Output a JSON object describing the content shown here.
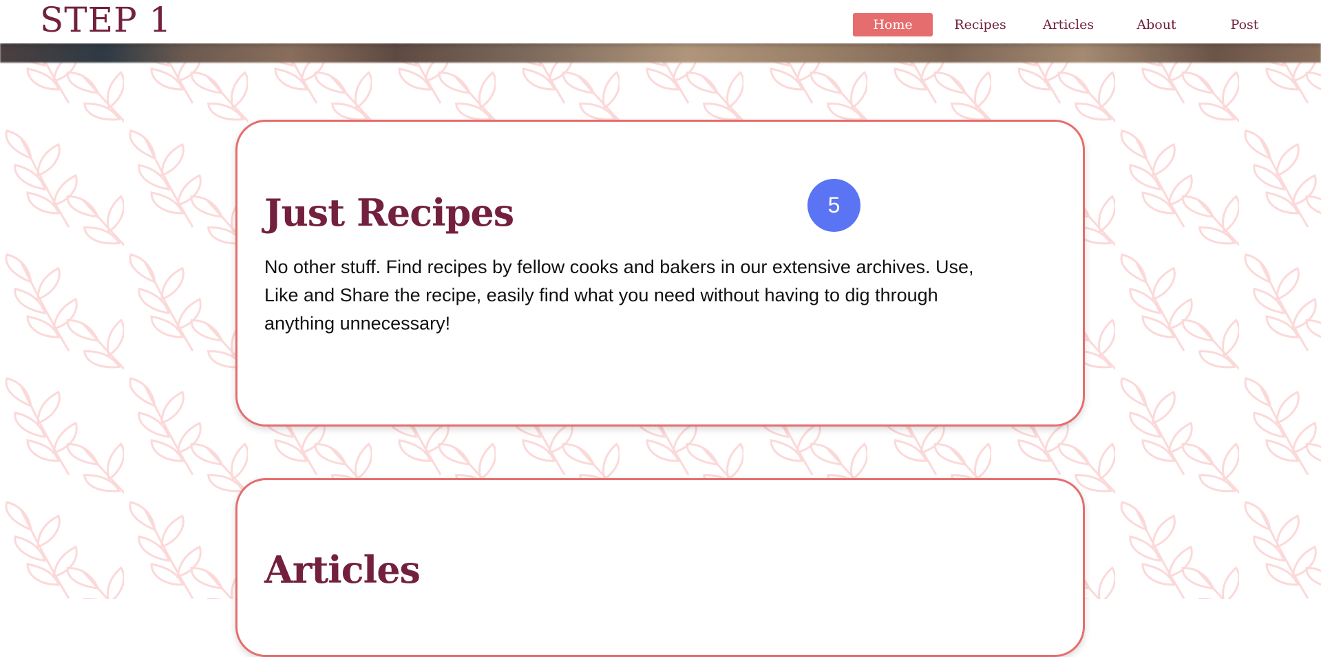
{
  "logo": "STEP 1",
  "nav": {
    "items": [
      {
        "label": "Home",
        "active": true
      },
      {
        "label": "Recipes",
        "active": false
      },
      {
        "label": "Articles",
        "active": false
      },
      {
        "label": "About",
        "active": false
      },
      {
        "label": "Post",
        "active": false
      }
    ]
  },
  "sections": [
    {
      "title": "Just Recipes",
      "description": "No other stuff. Find recipes by fellow cooks and bakers in our extensive archives. Use, Like and Share the recipe, easily find what you need without having to dig through anything unnecessary!",
      "badge": "5"
    },
    {
      "title": "Articles"
    }
  ],
  "colors": {
    "brand": "#73203f",
    "accent": "#e66d6d",
    "badge": "#5a74f3",
    "leaf_pattern": "#fcd9d9"
  },
  "icons": {
    "background": "leaf-pattern-icon"
  }
}
